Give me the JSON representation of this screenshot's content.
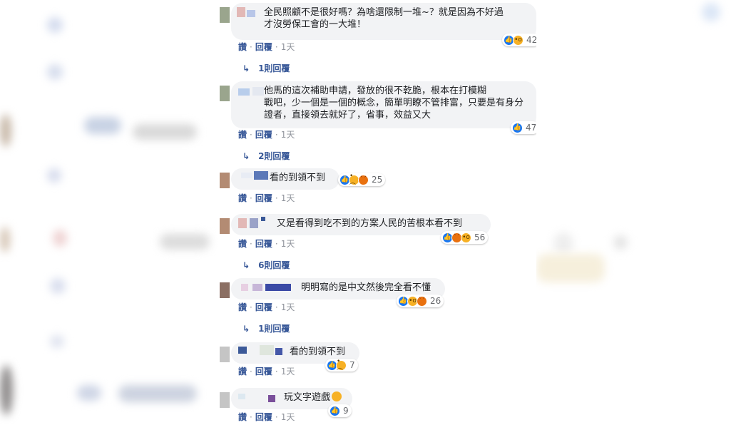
{
  "comments": [
    {
      "text": "全民照顧不是很好嗎？為啥還限制一堆~？就是因為不好過\n才沒勞保工會的一大堆！",
      "reaction_count": "42",
      "actions": {
        "like": "讚",
        "reply": "回覆",
        "time": "1天"
      },
      "replies_label": "1則回覆"
    },
    {
      "text": "他馬的這次補助申請，發放的很不乾脆，根本在打模糊\n戰吧，少一個是一個的概念，簡單明瞭不管排富，只要是有身分\n證者，直接領去就好了，省事，效益又大",
      "reaction_count": "47",
      "actions": {
        "like": "讚",
        "reply": "回覆",
        "time": "1天"
      },
      "replies_label": "2則回覆"
    },
    {
      "text": "看的到領不到",
      "reaction_count": "25",
      "actions": {
        "like": "讚",
        "reply": "回覆",
        "time": "1天"
      }
    },
    {
      "text": "又是看得到吃不到的方案人民的苦根本看不到",
      "reaction_count": "56",
      "actions": {
        "like": "讚",
        "reply": "回覆",
        "time": "1天"
      },
      "replies_label": "6則回覆"
    },
    {
      "text": "明明寫的是中文然後完全看不懂",
      "reaction_count": "26",
      "actions": {
        "like": "讚",
        "reply": "回覆",
        "time": "1天"
      },
      "replies_label": "1則回覆"
    },
    {
      "text": "看的到領不到",
      "reaction_count": "7",
      "actions": {
        "like": "讚",
        "reply": "回覆",
        "time": "1天"
      }
    },
    {
      "text": "玩文字遊戲",
      "reaction_count": "9",
      "actions": {
        "like": "讚",
        "reply": "回覆",
        "time": "1天"
      }
    }
  ],
  "colors": {
    "link": "#385898",
    "meta": "#90949c",
    "bubble": "#f2f3f5",
    "like_blue": "#1877f2",
    "emoji_yellow": "#f7b125",
    "angry_orange": "#e9710f"
  },
  "icons": {
    "reply_arrow": "reply-arrow-icon",
    "like": "like-reaction-icon",
    "wow": "wow-reaction-icon",
    "sad": "sad-reaction-icon",
    "angry": "angry-reaction-icon"
  }
}
